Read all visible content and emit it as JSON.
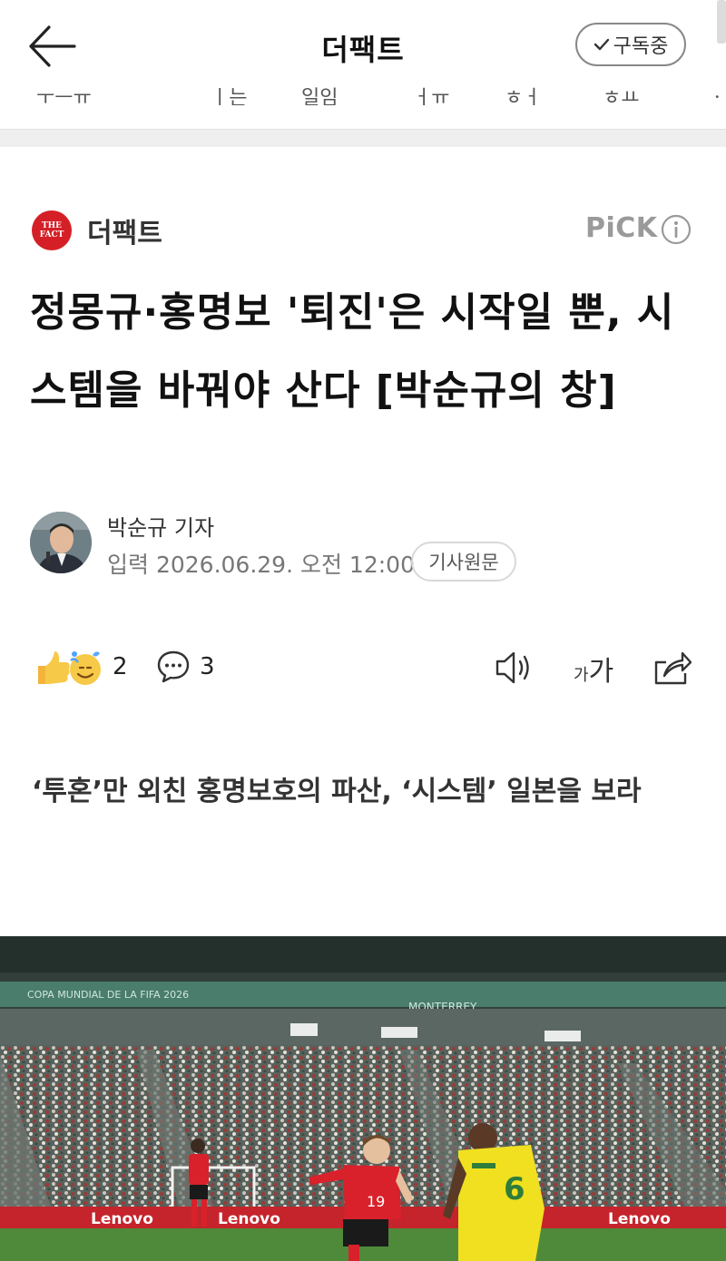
{
  "header": {
    "back_icon": "arrow-left-icon",
    "title": "더팩트",
    "subscribe_label": "구독중"
  },
  "menu_strip": [
    "ㅜㅡㅠ",
    "ㅣ는",
    "일임",
    "ㅓㅠ",
    "ㅎㅓ",
    "ㅎㅛ",
    "ㆍ"
  ],
  "press": {
    "logo_line1": "THE",
    "logo_line2": "FACT",
    "name": "더팩트",
    "pick_label": "PiCK"
  },
  "article": {
    "headline": "정몽규·홍명보 '퇴진'은 시작일 뿐, 시스템을 바꿔야 산다 [박순규의 창]",
    "author": "박순규 기자",
    "date": "입력 2026.06.29. 오전 12:00",
    "original_button": "기사원문",
    "reaction_count": "2",
    "comment_count": "3",
    "font_small": "가",
    "font_large": "가",
    "subtitle": "‘투혼’만 외친 홍명보호의 파산, ‘시스템’ 일본을 보라"
  },
  "photo": {
    "banner_text_1": "COPA MUNDIAL DE LA FIFA 2026",
    "banner_text_2": "MONTERREY",
    "board_text": "Lenovo",
    "player_red_number": "19",
    "player_yellow_number": "6",
    "colors": {
      "red_kit": "#d8212b",
      "yellow_kit": "#f0e020",
      "pitch": "#4f8a3a"
    }
  },
  "colors": {
    "accent_red": "#d51f26",
    "muted": "#9a9a9a"
  }
}
